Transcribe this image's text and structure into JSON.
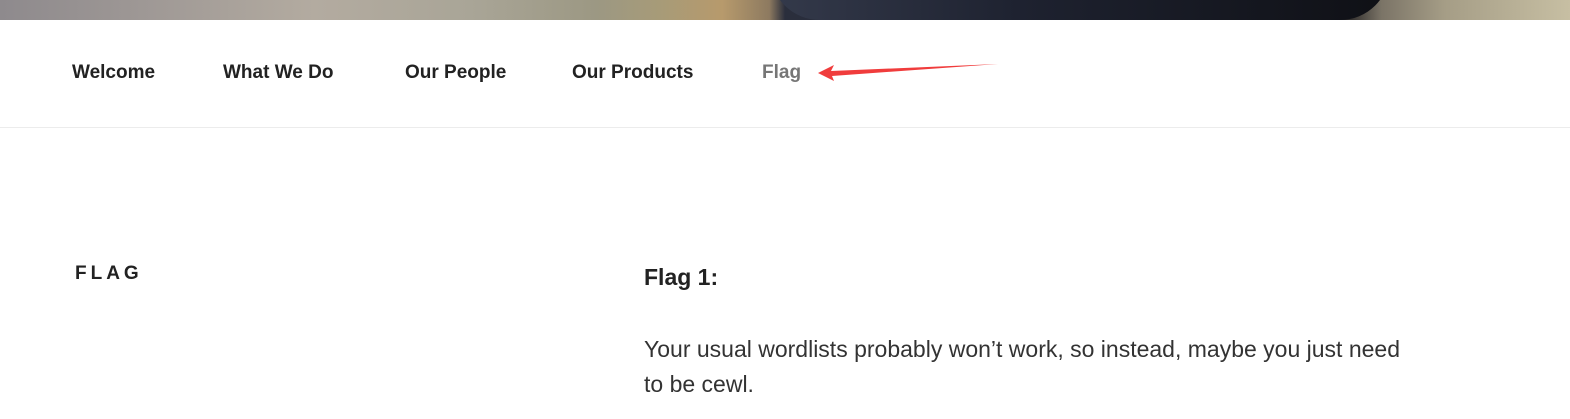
{
  "nav": {
    "items": [
      {
        "label": "Welcome"
      },
      {
        "label": "What We Do"
      },
      {
        "label": "Our People"
      },
      {
        "label": "Our Products"
      },
      {
        "label": "Flag"
      }
    ],
    "current_index": 4,
    "current_color": "#767676"
  },
  "annotation": {
    "color": "#f03c3c",
    "icon": "red-arrow-pointer"
  },
  "page": {
    "section_title": "FLAG",
    "entry_heading": "Flag 1:",
    "entry_text": "Your usual wordlists probably won’t work, so instead, maybe you just need to be cewl."
  }
}
